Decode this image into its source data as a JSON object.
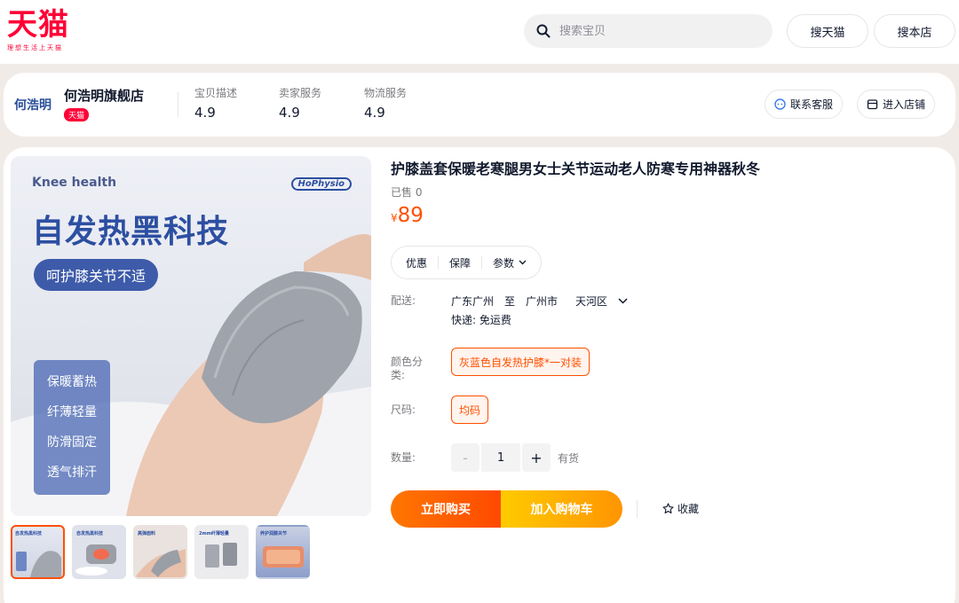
{
  "header": {
    "logo_text": "天猫",
    "logo_slogan": "理想生活上天猫",
    "search_placeholder": "搜索宝贝",
    "search_tmall_label": "搜天猫",
    "search_store_label": "搜本店"
  },
  "shop": {
    "logo_text": "何浩明",
    "name": "何浩明旗舰店",
    "badge": "天猫",
    "ratings": [
      {
        "label": "宝贝描述",
        "value": "4.9"
      },
      {
        "label": "卖家服务",
        "value": "4.9"
      },
      {
        "label": "物流服务",
        "value": "4.9"
      }
    ],
    "contact_label": "联系客服",
    "enter_store_label": "进入店铺"
  },
  "gallery": {
    "brand_text": "Knee health",
    "logo_text": "HoPhysio",
    "headline": "自发热黑科技",
    "pill_text": "呵护膝关节不适",
    "features": [
      "保暖蓄热",
      "纤薄轻量",
      "防滑固定",
      "透气排汗"
    ],
    "thumb_labels": [
      "自发热黑科技",
      "自发热黑科技",
      "高弹面料",
      "2mm纤薄轻量",
      "养护润膝关节"
    ]
  },
  "product": {
    "title": "护膝盖套保暖老寒腿男女士关节运动老人防寒专用神器秋冬",
    "sold": "已售 0",
    "currency": "¥",
    "price": "89",
    "tabs": [
      "优惠",
      "保障",
      "参数"
    ],
    "delivery_label": "配送:",
    "delivery_from": "广东广州",
    "delivery_to_word": "至",
    "delivery_city": "广州市",
    "delivery_district": "天河区",
    "delivery_fee": "快递: 免运费",
    "color_label": "颜色分类:",
    "color_option": "灰蓝色自发热护膝*一对装",
    "size_label": "尺码:",
    "size_option": "均码",
    "qty_label": "数量:",
    "qty_minus": "-",
    "qty_value": "1",
    "qty_plus": "+",
    "stock": "有货",
    "buy_now": "立即购买",
    "add_cart": "加入购物车",
    "favorite": "收藏"
  },
  "colors": {
    "brand_red": "#ff0036",
    "accent_orange": "#ff5000",
    "headline_blue": "#2d4fa2"
  }
}
